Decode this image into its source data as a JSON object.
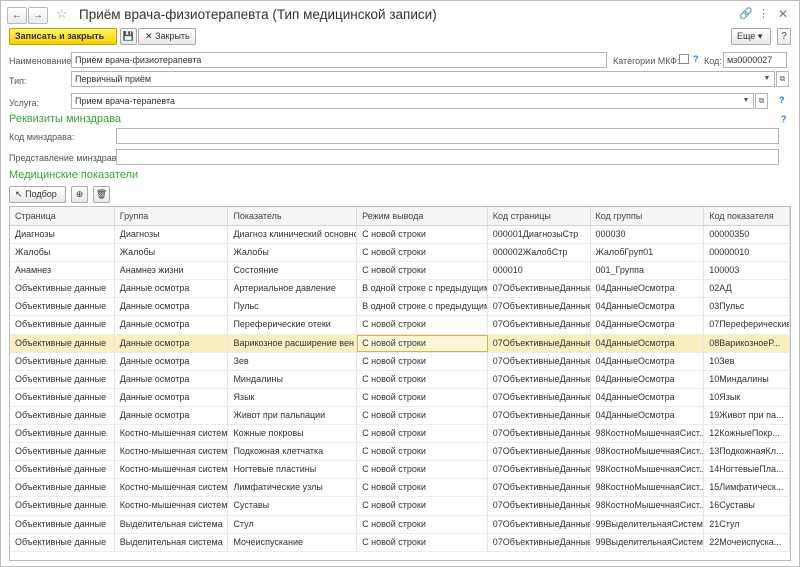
{
  "window": {
    "title": "Приём врача-физиотерапевта (Тип медицинской записи)"
  },
  "toolbar": {
    "save_close_label": "Записать и закрыть",
    "close_label": "Закрыть",
    "more_label": "Еще",
    "help_label": "?"
  },
  "form": {
    "name_label": "Наименование:",
    "name_value": "Приём врача-физиотерапевта",
    "mkf_label": "Категории МКФ:",
    "code_label": "Код:",
    "code_value": "мз0000027",
    "type_label": "Тип:",
    "type_value": "Первичный приём",
    "service_label": "Услуга:",
    "service_value": "Прием врача-терапевта"
  },
  "minzdrav": {
    "header": "Реквизиты минздрава",
    "code_label": "Код минздрава:",
    "code_value": "",
    "repr_label": "Представление минздрава:",
    "repr_value": ""
  },
  "medical": {
    "header": "Медицинские показатели",
    "select_label": "Подбор",
    "columns": [
      "Страница",
      "Группа",
      "Показатель",
      "Режим вывода",
      "Код страницы",
      "Код группы",
      "Код показателя"
    ],
    "rows": [
      [
        "Диагнозы",
        "Диагнозы",
        "Диагноз клинический основной",
        "С новой строки",
        "000001ДиагнозыСтр",
        "000030",
        "00000350"
      ],
      [
        "Жалобы",
        "Жалобы",
        "Жалобы",
        "С новой строки",
        "000002ЖалобСтр",
        "ЖалобГруп01",
        "00000010"
      ],
      [
        "Анамнез",
        "Анамнез жизни",
        "Состояние",
        "С новой строки",
        "000010",
        "001_Группа",
        "100003"
      ],
      [
        "Объективные данные",
        "Данные осмотра",
        "Артериальное давление",
        "В одной строке с предыдущим",
        "07ОбъективныеДанные",
        "04ДанныеОсмотра",
        "02АД"
      ],
      [
        "Объективные данные",
        "Данные осмотра",
        "Пульс",
        "В одной строке с предыдущим",
        "07ОбъективныеДанные",
        "04ДанныеОсмотра",
        "03Пульс"
      ],
      [
        "Объективные данные",
        "Данные осмотра",
        "Переферические отеки",
        "С новой строки",
        "07ОбъективныеДанные",
        "04ДанныеОсмотра",
        "07Переферические"
      ],
      [
        "Объективные данные",
        "Данные осмотра",
        "Варикозное расширение вен",
        "С новой строки",
        "07ОбъективныеДанные",
        "04ДанныеОсмотра",
        "08ВарикозноеР..."
      ],
      [
        "Объективные данные",
        "Данные осмотра",
        "Зев",
        "С новой строки",
        "07ОбъективныеДанные",
        "04ДанныеОсмотра",
        "10Зев"
      ],
      [
        "Объективные данные",
        "Данные осмотра",
        "Миндалины",
        "С новой строки",
        "07ОбъективныеДанные",
        "04ДанныеОсмотра",
        "10Миндалины"
      ],
      [
        "Объективные данные",
        "Данные осмотра",
        "Язык",
        "С новой строки",
        "07ОбъективныеДанные",
        "04ДанныеОсмотра",
        "10Язык"
      ],
      [
        "Объективные данные",
        "Данные осмотра",
        "Живот при пальпации",
        "С новой строки",
        "07ОбъективныеДанные",
        "04ДанныеОсмотра",
        "19Живот при па..."
      ],
      [
        "Объективные данные",
        "Костно-мышечная система",
        "Кожные покровы",
        "С новой строки",
        "07ОбъективныеДанные",
        "98КостноМышечнаяСист...",
        "12КожныеПокр..."
      ],
      [
        "Объективные данные",
        "Костно-мышечная система",
        "Подкожная клетчатка",
        "С новой строки",
        "07ОбъективныеДанные",
        "98КостноМышечнаяСист...",
        "13ПодкожнаяКл..."
      ],
      [
        "Объективные данные",
        "Костно-мышечная система",
        "Ногтевые пластины",
        "С новой строки",
        "07ОбъективныеДанные",
        "98КостноМышечнаяСист...",
        "14НогтевыеПла..."
      ],
      [
        "Объективные данные",
        "Костно-мышечная система",
        "Лимфатические узлы",
        "С новой строки",
        "07ОбъективныеДанные",
        "98КостноМышечнаяСист...",
        "15Лимфатическ..."
      ],
      [
        "Объективные данные",
        "Костно-мышечная система",
        "Суставы",
        "С новой строки",
        "07ОбъективныеДанные",
        "98КостноМышечнаяСист...",
        "16Суставы"
      ],
      [
        "Объективные данные",
        "Выделительная система",
        "Стул",
        "С новой строки",
        "07ОбъективныеДанные",
        "99ВыделительнаяСистем...",
        "21Стул"
      ],
      [
        "Объективные данные",
        "Выделительная система",
        "Мочеиспускание",
        "С новой строки",
        "07ОбъективныеДанные",
        "99ВыделительнаяСистем...",
        "22Мочеиспуска..."
      ]
    ],
    "selected_row": 6
  },
  "colors": {
    "accent_green": "#3ca03c",
    "primary_button": "#f3cf09",
    "selected_row": "#fbeec0",
    "help_blue": "#2b7bd6"
  }
}
